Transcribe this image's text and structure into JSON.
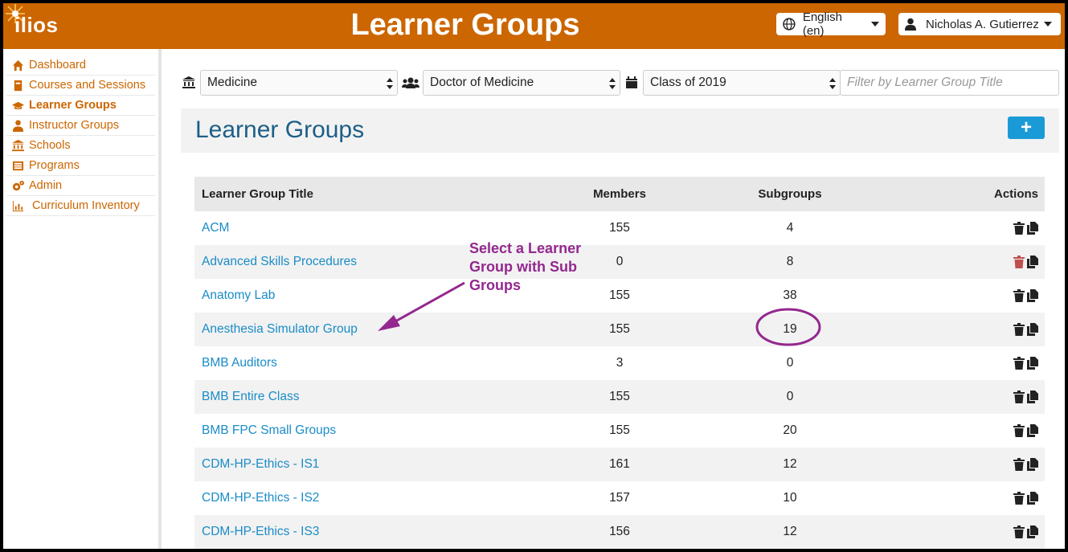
{
  "header": {
    "logo": "ilios",
    "title": "Learner Groups",
    "language": "English (en)",
    "user": "Nicholas A. Gutierrez"
  },
  "sidebar": {
    "items": [
      {
        "label": "Dashboard",
        "icon": "home-icon"
      },
      {
        "label": "Courses and Sessions",
        "icon": "book-icon"
      },
      {
        "label": "Learner Groups",
        "icon": "graduation-cap-icon",
        "active": true
      },
      {
        "label": "Instructor Groups",
        "icon": "user-md-icon"
      },
      {
        "label": "Schools",
        "icon": "university-icon"
      },
      {
        "label": "Programs",
        "icon": "list-alt-icon"
      },
      {
        "label": "Admin",
        "icon": "cogs-icon"
      },
      {
        "label": "Curriculum Inventory",
        "icon": "bar-chart-icon"
      }
    ]
  },
  "filters": {
    "school": "Medicine",
    "program": "Doctor of Medicine",
    "cohort": "Class of 2019",
    "search_placeholder": "Filter by Learner Group Title"
  },
  "main": {
    "title": "Learner Groups",
    "add_label": "+",
    "columns": [
      "Learner Group Title",
      "Members",
      "Subgroups",
      "Actions"
    ],
    "rows": [
      {
        "title": "ACM",
        "members": "155",
        "subgroups": "4"
      },
      {
        "title": "Advanced Skills Procedures",
        "members": "0",
        "subgroups": "8",
        "delete_enabled": true
      },
      {
        "title": "Anatomy Lab",
        "members": "155",
        "subgroups": "38"
      },
      {
        "title": "Anesthesia Simulator Group",
        "members": "155",
        "subgroups": "19"
      },
      {
        "title": "BMB Auditors",
        "members": "3",
        "subgroups": "0"
      },
      {
        "title": "BMB Entire Class",
        "members": "155",
        "subgroups": "0"
      },
      {
        "title": "BMB FPC Small Groups",
        "members": "155",
        "subgroups": "20"
      },
      {
        "title": "CDM-HP-Ethics - IS1",
        "members": "161",
        "subgroups": "12"
      },
      {
        "title": "CDM-HP-Ethics - IS2",
        "members": "157",
        "subgroups": "10"
      },
      {
        "title": "CDM-HP-Ethics - IS3",
        "members": "156",
        "subgroups": "12"
      }
    ]
  },
  "annotation": {
    "lines": [
      "Select a Learner",
      "Group with Sub",
      "Groups"
    ],
    "color": "#93288f"
  },
  "colors": {
    "brand": "#cc6600",
    "link": "#1a8cc7",
    "title": "#1d5f87",
    "add_button": "#1a9bd7",
    "delete_active": "#c0504d"
  }
}
